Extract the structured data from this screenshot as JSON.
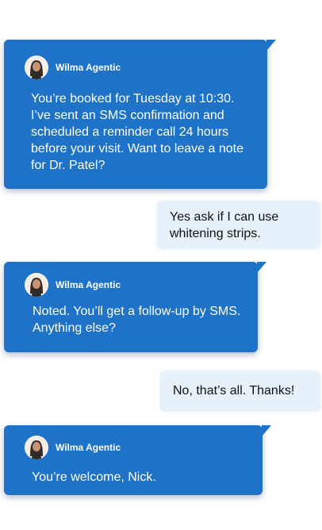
{
  "agent": {
    "name": "Wilma Agentic",
    "avatar_icon": "woman-avatar-icon"
  },
  "colors": {
    "agent_bubble": "#1E73C8",
    "user_bubble": "#E7F1FB"
  },
  "messages": [
    {
      "from": "agent",
      "text": "You’re booked for Tuesday at 10:30.\nI’ve sent an SMS confirmation and\nscheduled a reminder call 24 hours\nbefore your visit. Want to leave a note\nfor Dr. Patel?"
    },
    {
      "from": "user",
      "text": "Yes   ask if I can use\nwhitening strips."
    },
    {
      "from": "agent",
      "text": "Noted. You’ll get a follow-up by SMS.\nAnything else?"
    },
    {
      "from": "user",
      "text": "No, that’s all. Thanks!"
    },
    {
      "from": "agent",
      "text": "You’re welcome, Nick."
    }
  ]
}
